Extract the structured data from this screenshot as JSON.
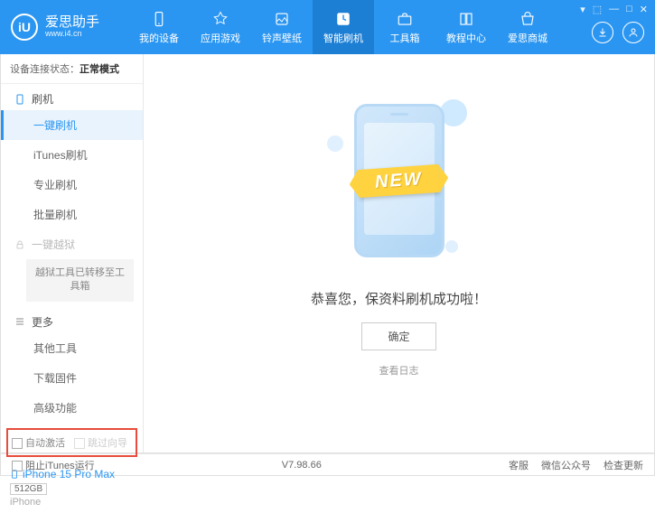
{
  "header": {
    "app_name": "爱思助手",
    "site": "www.i4.cn",
    "logo_letter": "iU"
  },
  "nav": [
    {
      "label": "我的设备"
    },
    {
      "label": "应用游戏"
    },
    {
      "label": "铃声壁纸"
    },
    {
      "label": "智能刷机",
      "active": true
    },
    {
      "label": "工具箱"
    },
    {
      "label": "教程中心"
    },
    {
      "label": "爱思商城"
    }
  ],
  "sidebar": {
    "status_label": "设备连接状态：",
    "status_value": "正常模式",
    "flash_section": "刷机",
    "flash_items": [
      "一键刷机",
      "iTunes刷机",
      "专业刷机",
      "批量刷机"
    ],
    "jailbreak_section": "一键越狱",
    "jailbreak_note": "越狱工具已转移至工具箱",
    "more_section": "更多",
    "more_items": [
      "其他工具",
      "下载固件",
      "高级功能"
    ],
    "auto_activate": "自动激活",
    "skip_guide": "跳过向导"
  },
  "device": {
    "name": "iPhone 15 Pro Max",
    "storage": "512GB",
    "type": "iPhone"
  },
  "main": {
    "new_label": "NEW",
    "success": "恭喜您，保资料刷机成功啦！",
    "ok": "确定",
    "view_log": "查看日志"
  },
  "footer": {
    "block_itunes": "阻止iTunes运行",
    "version": "V7.98.66",
    "links": [
      "客服",
      "微信公众号",
      "检查更新"
    ]
  }
}
